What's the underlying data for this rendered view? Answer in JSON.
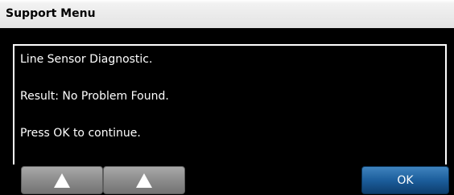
{
  "window": {
    "title": "Support Menu"
  },
  "message": {
    "lines": [
      "Line Sensor Diagnostic.",
      "Result: No Problem Found.",
      "Press OK to continue."
    ]
  },
  "buttons": {
    "up_1_icon": "up-triangle-icon",
    "up_2_icon": "up-triangle-icon",
    "ok_label": "OK"
  },
  "colors": {
    "background": "#000000",
    "titlebar": "#e3e3e3",
    "ok_button": "#1c5e9c",
    "arrow_button": "#8c8c8c"
  }
}
